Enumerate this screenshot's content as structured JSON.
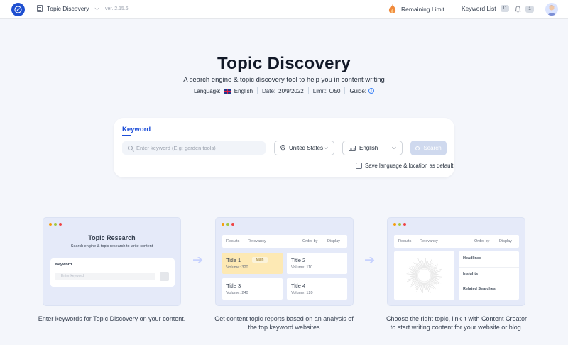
{
  "topbar": {
    "app_name": "Topic Discovery",
    "version": "ver. 2.15.6",
    "remaining_label": "Remaining Limit",
    "keyword_list_label": "Keyword List",
    "keyword_list_count": "11",
    "notification_count": "1"
  },
  "hero": {
    "title": "Topic Discovery",
    "subtitle": "A search engine & topic discovery tool to help you in content writing",
    "language_label": "Language:",
    "language_value": "English",
    "date_label": "Date:",
    "date_value": "20/9/2022",
    "limit_label": "Limit:",
    "limit_value": "0/50",
    "guide_label": "Guide:"
  },
  "search": {
    "section_label": "Keyword",
    "placeholder": "Enter keyword (E.g: garden tools)",
    "country": "United States",
    "language": "English",
    "button": "Search",
    "save_default": "Save language & location as default"
  },
  "steps": [
    {
      "preview_title": "Topic Research",
      "preview_subtitle": "Search engine & topic research to write content",
      "preview_keyword_label": "Keyword",
      "preview_placeholder": "Enter keyword",
      "caption": "Enter keywords for Topic Discovery on your content."
    },
    {
      "bar_results": "Results",
      "bar_relevancy": "Relevancy",
      "bar_order": "Order by",
      "bar_display": "Display",
      "main_badge": "Main",
      "tiles": [
        {
          "title": "Title 1",
          "volume": "Volume: 320"
        },
        {
          "title": "Title 2",
          "volume": "Volume: 110"
        },
        {
          "title": "Title 3",
          "volume": "Volume: 240"
        },
        {
          "title": "Title 4",
          "volume": "Volume: 120"
        }
      ],
      "caption_line1": "Get content topic reports based on an analysis of",
      "caption_line2": "the top keyword websites"
    },
    {
      "bar_results": "Results",
      "bar_relevancy": "Relevancy",
      "bar_order": "Order by",
      "bar_display": "Display",
      "side_items": [
        "Headlines",
        "Insights",
        "Related Searches"
      ],
      "caption_line1": "Choose the right topic, link it with Content Creator",
      "caption_line2": "to start writing content for your website or blog."
    }
  ],
  "colors": {
    "brand": "#1e4fd0",
    "accent": "#1d4ed8",
    "search_button_disabled": "#cfd9ee",
    "highlight_tile": "#fde9b4"
  },
  "icons": [
    "compass-logo-icon",
    "document-icon",
    "chevron-down-icon",
    "flame-icon",
    "list-icon",
    "bell-icon",
    "uk-flag-icon",
    "info-icon",
    "search-icon",
    "location-pin-icon",
    "translate-icon",
    "checkbox-icon",
    "arrow-right-icon"
  ]
}
